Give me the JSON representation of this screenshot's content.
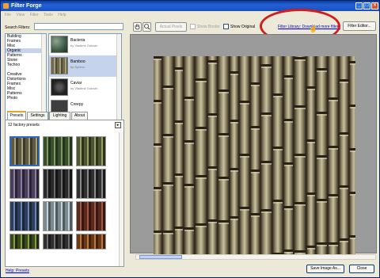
{
  "window": {
    "title": "Filter Forge",
    "menu": [
      "File",
      "View",
      "Filter",
      "Tools",
      "Help"
    ]
  },
  "left": {
    "search_label": "Search Filters:",
    "categories": [
      "Building",
      "Frames",
      "Misc",
      "Organic",
      "Patterns",
      "Stone",
      "Techno",
      "",
      "Creative",
      "Distortions",
      "Frames",
      "Misc",
      "Patterns",
      "Photo"
    ],
    "selected_category_index": 3,
    "filters": [
      {
        "name": "Bacteria",
        "author": "by Vladimir Golovin"
      },
      {
        "name": "Bamboo",
        "author": "by Sphinx."
      },
      {
        "name": "Caviar",
        "author": "by Vladimir Golovin"
      },
      {
        "name": "Creepy",
        "author": ""
      }
    ],
    "selected_filter_index": 1,
    "tabs": [
      "Presets",
      "Settings",
      "Lighting",
      "About"
    ],
    "active_tab_index": 0,
    "preset_count": "12 factory presets",
    "preset_arrow": "▸",
    "help_link": "Help: Presets"
  },
  "toolbar": {
    "actual_pixels": "Actual Pixels",
    "show_border": "Show Border",
    "show_original": "Show Original",
    "library_link": "Filter Library: Download more filters",
    "editor_button": "Filter Editor..."
  },
  "bottom": {
    "save_button": "Save Image As...",
    "close_button": "Close"
  },
  "colors": {
    "annotation": "#d11d1d",
    "link": "#0000cc",
    "title_bar": "#2461d6"
  }
}
